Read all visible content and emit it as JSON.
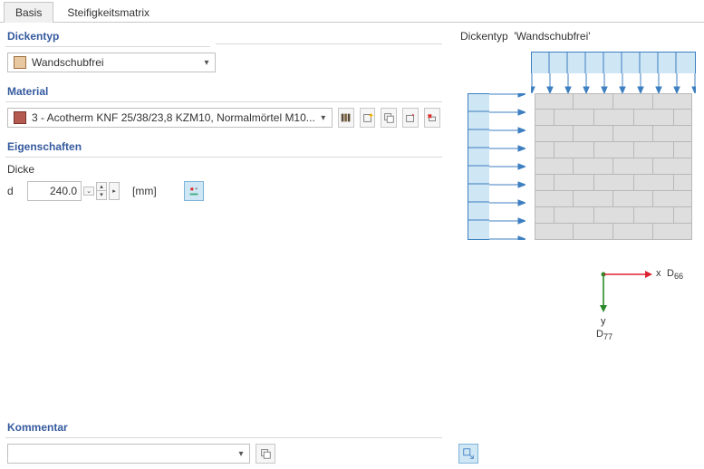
{
  "tabs": {
    "basis": "Basis",
    "steifigkeitsmatrix": "Steifigkeitsmatrix",
    "activeIndex": 0
  },
  "dickentyp": {
    "title": "Dickentyp",
    "selected": "Wandschubfrei"
  },
  "material": {
    "title": "Material",
    "selected": "3 - Acotherm KNF 25/38/23,8 KZM10, Normalmörtel M10..."
  },
  "eigenschaften": {
    "title": "Eigenschaften",
    "dicke_label": "Dicke",
    "dicke_symbol": "d",
    "dicke_value": "240.0",
    "dicke_unit": "[mm]"
  },
  "kommentar": {
    "title": "Kommentar",
    "selected": ""
  },
  "preview": {
    "title_prefix": "Dickentyp",
    "title_name": "'Wandschubfrei'",
    "axis_x": "x",
    "label_D66": "D",
    "sub_D66": "66",
    "axis_y": "y",
    "label_D77": "D",
    "sub_D77": "77"
  },
  "icons": {
    "library": "library-icon",
    "new": "new-sparkle-icon",
    "duplicate": "duplicate-icon",
    "edit": "edit-icon",
    "delete": "delete-link-icon",
    "segment_edit": "segment-edit-icon",
    "copy": "copy-icon",
    "expand": "expand-diagram-icon"
  }
}
